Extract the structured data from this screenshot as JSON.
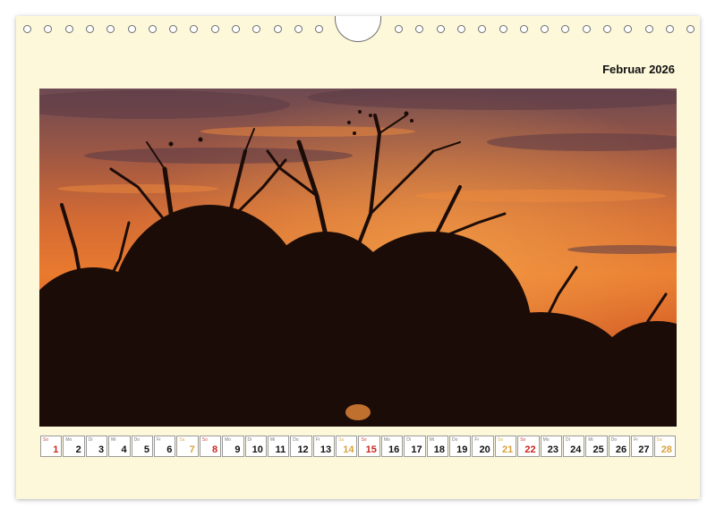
{
  "calendar": {
    "month_label": "Februar 2026",
    "days": [
      {
        "wd": "So",
        "num": "1",
        "kind": "sun"
      },
      {
        "wd": "Mo",
        "num": "2",
        "kind": "week"
      },
      {
        "wd": "Di",
        "num": "3",
        "kind": "week"
      },
      {
        "wd": "Mi",
        "num": "4",
        "kind": "week"
      },
      {
        "wd": "Do",
        "num": "5",
        "kind": "week"
      },
      {
        "wd": "Fr",
        "num": "6",
        "kind": "week"
      },
      {
        "wd": "Sa",
        "num": "7",
        "kind": "sat"
      },
      {
        "wd": "So",
        "num": "8",
        "kind": "sun"
      },
      {
        "wd": "Mo",
        "num": "9",
        "kind": "week"
      },
      {
        "wd": "Di",
        "num": "10",
        "kind": "week"
      },
      {
        "wd": "Mi",
        "num": "11",
        "kind": "week"
      },
      {
        "wd": "Do",
        "num": "12",
        "kind": "week"
      },
      {
        "wd": "Fr",
        "num": "13",
        "kind": "week"
      },
      {
        "wd": "Sa",
        "num": "14",
        "kind": "sat"
      },
      {
        "wd": "So",
        "num": "15",
        "kind": "sun"
      },
      {
        "wd": "Mo",
        "num": "16",
        "kind": "week"
      },
      {
        "wd": "Di",
        "num": "17",
        "kind": "week"
      },
      {
        "wd": "Mi",
        "num": "18",
        "kind": "week"
      },
      {
        "wd": "Do",
        "num": "19",
        "kind": "week"
      },
      {
        "wd": "Fr",
        "num": "20",
        "kind": "week"
      },
      {
        "wd": "Sa",
        "num": "21",
        "kind": "sat"
      },
      {
        "wd": "So",
        "num": "22",
        "kind": "sun"
      },
      {
        "wd": "Mo",
        "num": "23",
        "kind": "week"
      },
      {
        "wd": "Di",
        "num": "24",
        "kind": "week"
      },
      {
        "wd": "Mi",
        "num": "25",
        "kind": "week"
      },
      {
        "wd": "Do",
        "num": "26",
        "kind": "week"
      },
      {
        "wd": "Fr",
        "num": "27",
        "kind": "week"
      },
      {
        "wd": "Sa",
        "num": "28",
        "kind": "sat"
      }
    ]
  },
  "colors": {
    "paper": "#fdf8da",
    "saturday": "#d8a23a",
    "sunday": "#c8261e"
  },
  "icons": {
    "hanger": "hanger-notch-icon",
    "hole": "binding-hole-icon"
  }
}
